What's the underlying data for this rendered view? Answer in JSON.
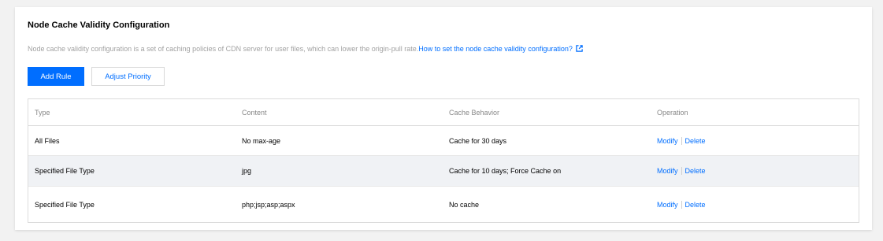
{
  "panel": {
    "title": "Node Cache Validity Configuration",
    "description": "Node cache validity configuration is a set of caching policies of CDN server for user files, which can lower the origin-pull rate.",
    "help_link": "How to set the node cache validity configuration?",
    "help_icon": "external-link-icon"
  },
  "toolbar": {
    "add_rule": "Add Rule",
    "adjust_priority": "Adjust Priority"
  },
  "table": {
    "headers": {
      "type": "Type",
      "content": "Content",
      "cache_behavior": "Cache Behavior",
      "operation": "Operation"
    },
    "rows": [
      {
        "type": "All Files",
        "content": "No max-age",
        "cache_behavior": "Cache for 30 days",
        "modify": "Modify",
        "delete": "Delete"
      },
      {
        "type": "Specified File Type",
        "content": "jpg",
        "cache_behavior": "Cache for 10 days; Force Cache on",
        "modify": "Modify",
        "delete": "Delete"
      },
      {
        "type": "Specified File Type",
        "content": "php;jsp;asp;aspx",
        "cache_behavior": "No cache",
        "modify": "Modify",
        "delete": "Delete"
      }
    ]
  },
  "colors": {
    "accent": "#006eff",
    "row_highlight": "#f0f2f5",
    "page_background": "#f2f2f2"
  }
}
